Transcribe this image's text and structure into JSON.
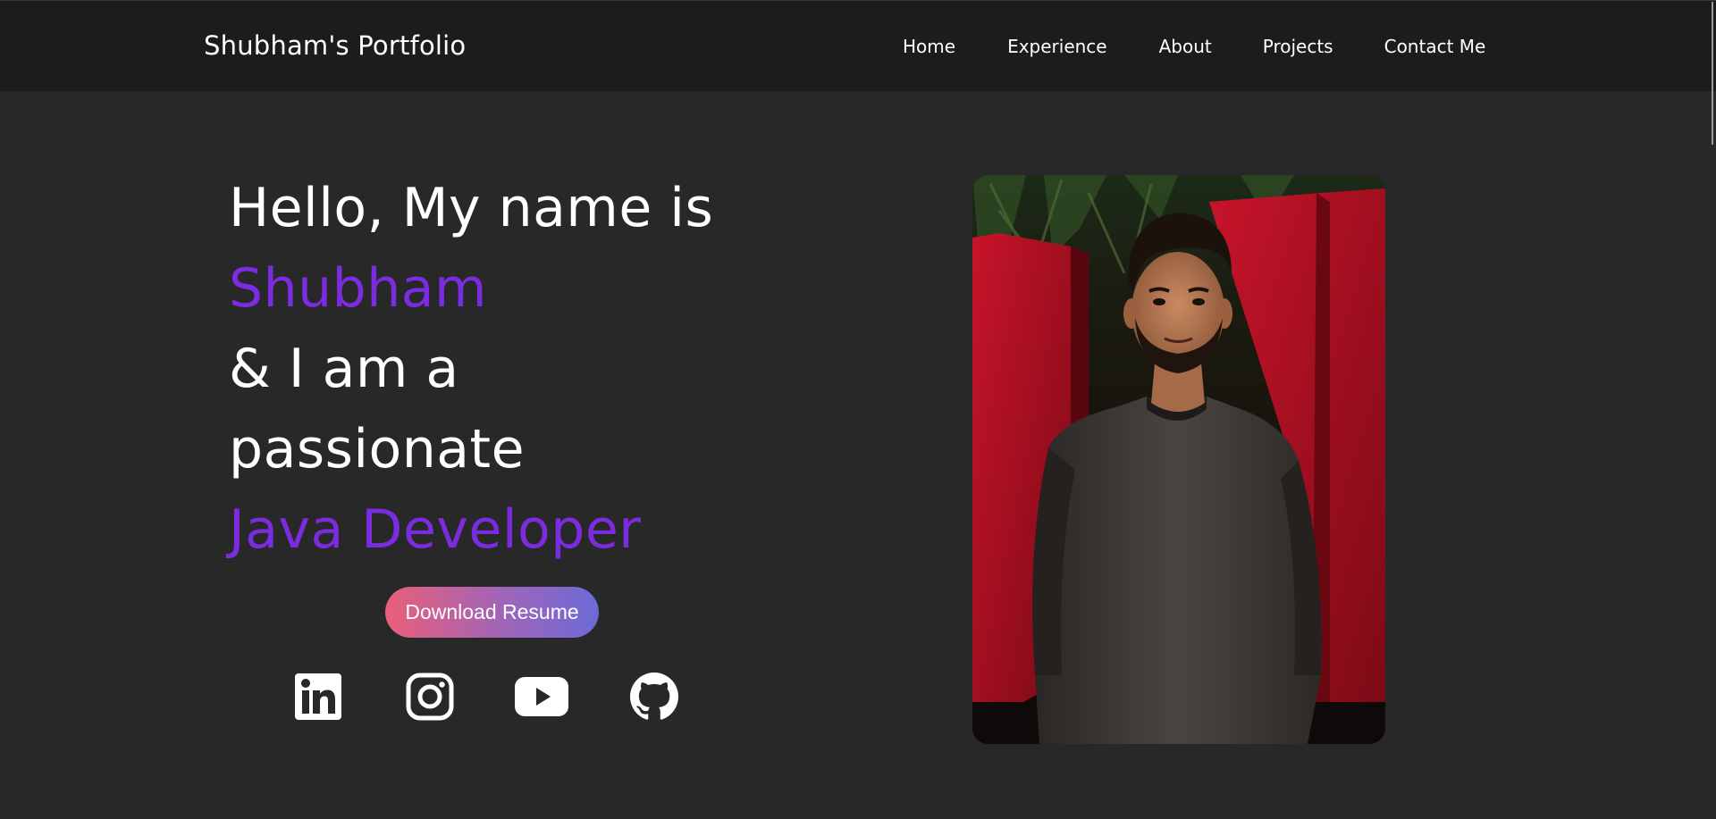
{
  "header": {
    "brand": "Shubham's Portfolio",
    "nav": [
      {
        "label": "Home"
      },
      {
        "label": "Experience"
      },
      {
        "label": "About"
      },
      {
        "label": "Projects"
      },
      {
        "label": "Contact Me"
      }
    ]
  },
  "hero": {
    "line1": "Hello, My name is",
    "name": "Shubham",
    "line3": "& I am a",
    "line4": "passionate",
    "role": "Java Developer",
    "resume_label": "Download Resume"
  },
  "social": [
    {
      "icon": "linkedin-icon"
    },
    {
      "icon": "instagram-icon"
    },
    {
      "icon": "youtube-icon"
    },
    {
      "icon": "github-icon"
    }
  ],
  "colors": {
    "background": "#282828",
    "header": "#1c1c1c",
    "accent": "#7b2ce0",
    "button_gradient_start": "#ea5f78",
    "button_gradient_end": "#6c6ad8"
  }
}
